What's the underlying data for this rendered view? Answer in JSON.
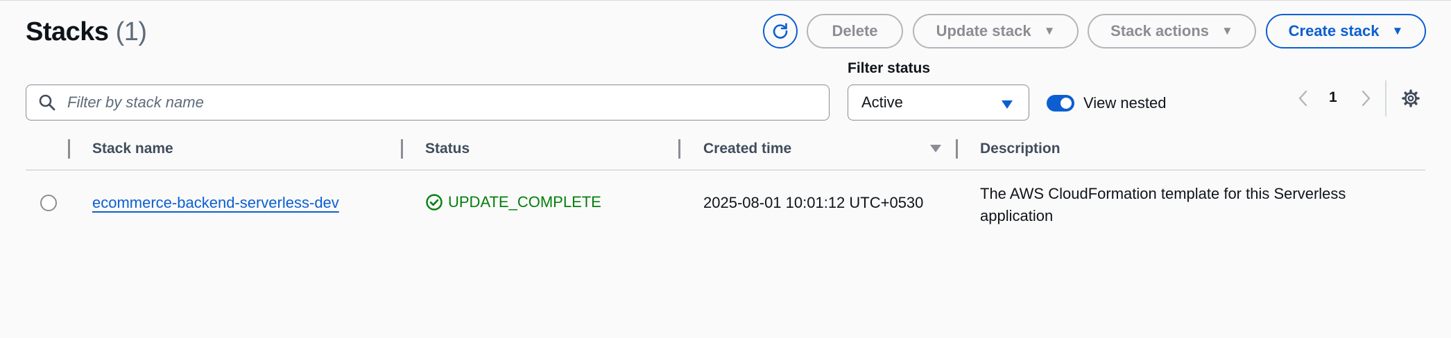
{
  "header": {
    "title": "Stacks",
    "count": "(1)"
  },
  "toolbar": {
    "refresh_icon": "refresh-icon",
    "delete_label": "Delete",
    "update_stack_label": "Update stack",
    "stack_actions_label": "Stack actions",
    "create_stack_label": "Create stack"
  },
  "filters": {
    "search_placeholder": "Filter by stack name",
    "search_value": "",
    "status_label": "Filter status",
    "status_value": "Active",
    "view_nested_label": "View nested",
    "view_nested_on": true
  },
  "pagination": {
    "current_page": "1"
  },
  "table": {
    "columns": [
      "Stack name",
      "Status",
      "Created time",
      "Description"
    ],
    "sorted_column": "Created time",
    "sort_direction": "descending",
    "rows": [
      {
        "stack_name": "ecommerce-backend-serverless-dev",
        "status": "UPDATE_COMPLETE",
        "created_time": "2025-08-01 10:01:12 UTC+0530",
        "description": "The AWS CloudFormation template for this Serverless application"
      }
    ]
  },
  "colors": {
    "accent": "#0b5fd1",
    "success": "#037f0c",
    "disabled": "#8c8c94",
    "background": "#fafafa"
  }
}
